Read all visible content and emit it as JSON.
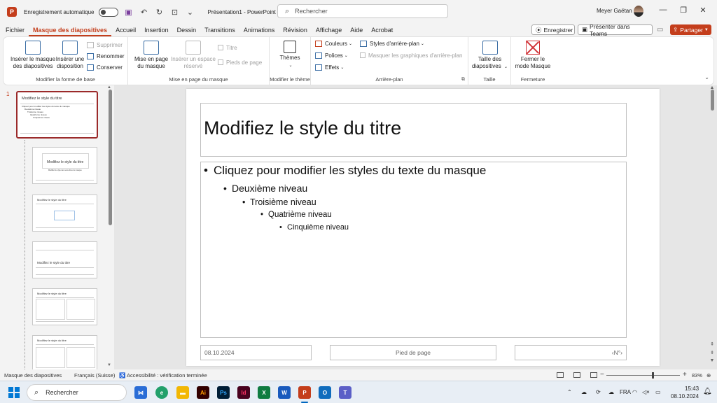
{
  "colors": {
    "accent": "#c43e1c",
    "ribbon_bg": "#ffffff",
    "window_bg": "#f3f3f3"
  },
  "titlebar": {
    "autosave_label": "Enregistrement automatique",
    "autosave_state": "Désactivé",
    "document_title": "Présentation1  -  PowerPoint",
    "search_placeholder": "Rechercher",
    "user_name": "Meyer Gaëtan"
  },
  "tabs": [
    {
      "label": "Fichier"
    },
    {
      "label": "Masque des diapositives",
      "active": true
    },
    {
      "label": "Accueil"
    },
    {
      "label": "Insertion"
    },
    {
      "label": "Dessin"
    },
    {
      "label": "Transitions"
    },
    {
      "label": "Animations"
    },
    {
      "label": "Révision"
    },
    {
      "label": "Affichage"
    },
    {
      "label": "Aide"
    },
    {
      "label": "Acrobat"
    }
  ],
  "header_actions": {
    "record": "Enregistrer",
    "present": "Présenter dans Teams",
    "share": "Partager"
  },
  "ribbon": {
    "edit_master": {
      "label": "Modifier la forme de base",
      "insert_master": "Insérer le masque des diapositives",
      "insert_layout": "Insérer une disposition",
      "delete": "Supprimer",
      "rename": "Renommer",
      "preserve": "Conserver"
    },
    "master_layout": {
      "label": "Mise en page du masque",
      "master_layout": "Mise en page du masque",
      "insert_placeholder": "Insérer un espace réservé",
      "title": "Titre",
      "footers": "Pieds de page"
    },
    "edit_theme": {
      "label": "Modifier le thème",
      "themes": "Thèmes"
    },
    "background": {
      "label": "Arrière-plan",
      "colors": "Couleurs",
      "fonts": "Polices",
      "effects": "Effets",
      "background_styles": "Styles d'arrière-plan",
      "hide_background": "Masquer les graphiques d'arrière-plan"
    },
    "size": {
      "label": "Taille",
      "slide_size": "Taille des diapositives"
    },
    "close": {
      "label": "Fermeture",
      "close_master": "Fermer le mode Masque"
    }
  },
  "thumbnails": {
    "master_number": "1",
    "master": {
      "title": "Modifiez le style du titre",
      "lines": [
        "Cliquez pour modifier les styles du texte du masque",
        "Deuxième niveau",
        "Troisième niveau",
        "Quatrième niveau",
        "Cinquième niveau"
      ]
    },
    "layouts": [
      {
        "title": "Modifiez le style du titre",
        "subtitle": "Modifiez le style des sous-titres du masque"
      },
      {
        "title": "Modifiez le style du titre"
      },
      {
        "title": "Modifiez le style du titre"
      },
      {
        "title": "Modifiez le style du titre"
      },
      {
        "title": "Modifiez le style du titre"
      }
    ]
  },
  "slide": {
    "title": "Modifiez le style du titre",
    "levels": [
      "Cliquez pour modifier les styles du texte du masque",
      "Deuxième niveau",
      "Troisième niveau",
      "Quatrième niveau",
      "Cinquième niveau"
    ],
    "date": "08.10.2024",
    "footer": "Pied de page",
    "number": "‹N°›"
  },
  "statusbar": {
    "view": "Masque des diapositives",
    "language": "Français (Suisse)",
    "accessibility": "Accessibilité : vérification terminée",
    "zoom": "83%"
  },
  "taskbar": {
    "search": "Rechercher",
    "language": "FRA",
    "time": "15:43",
    "date": "08.10.2024"
  }
}
